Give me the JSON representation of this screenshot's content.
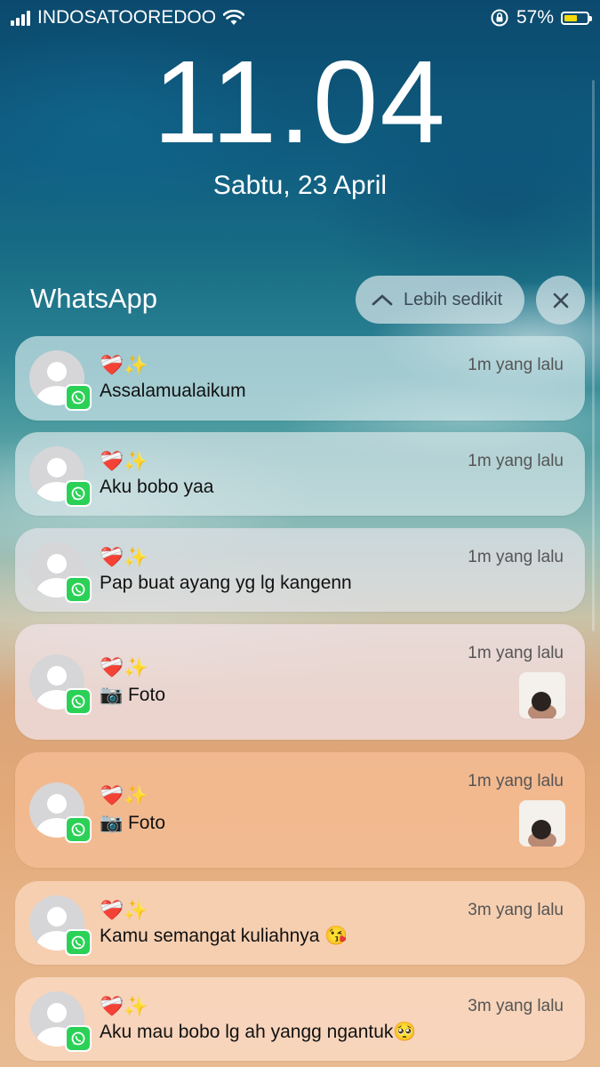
{
  "status_bar": {
    "carrier": "INDOSATOOREDOO",
    "battery_percent": "57%",
    "battery_level": 0.57,
    "battery_color": "#f5d90a"
  },
  "lockscreen": {
    "time": "11.04",
    "date": "Sabtu, 23 April"
  },
  "group": {
    "app_name": "WhatsApp",
    "show_less_label": "Lebih sedikit",
    "close_icon": "close-icon"
  },
  "notifications": [
    {
      "sender": "❤️‍🩹✨",
      "message": "Assalamualaikum",
      "time": "1m yang lalu",
      "has_thumb": false
    },
    {
      "sender": "❤️‍🩹✨",
      "message": "Aku bobo yaa",
      "time": "1m yang lalu",
      "has_thumb": false
    },
    {
      "sender": "❤️‍🩹✨",
      "message": "Pap buat ayang yg lg kangenn",
      "time": "1m yang lalu",
      "has_thumb": false
    },
    {
      "sender": "❤️‍🩹✨",
      "message": "📷 Foto",
      "time": "1m yang lalu",
      "has_thumb": true
    },
    {
      "sender": "❤️‍🩹✨",
      "message": "📷 Foto",
      "time": "1m yang lalu",
      "has_thumb": true
    },
    {
      "sender": "❤️‍🩹✨",
      "message": "Kamu semangat kuliahnya 😘",
      "time": "3m yang lalu",
      "has_thumb": false
    },
    {
      "sender": "❤️‍🩹✨",
      "message": "Aku mau bobo lg ah yangg ngantuk🥺",
      "time": "3m yang lalu",
      "has_thumb": false
    }
  ]
}
